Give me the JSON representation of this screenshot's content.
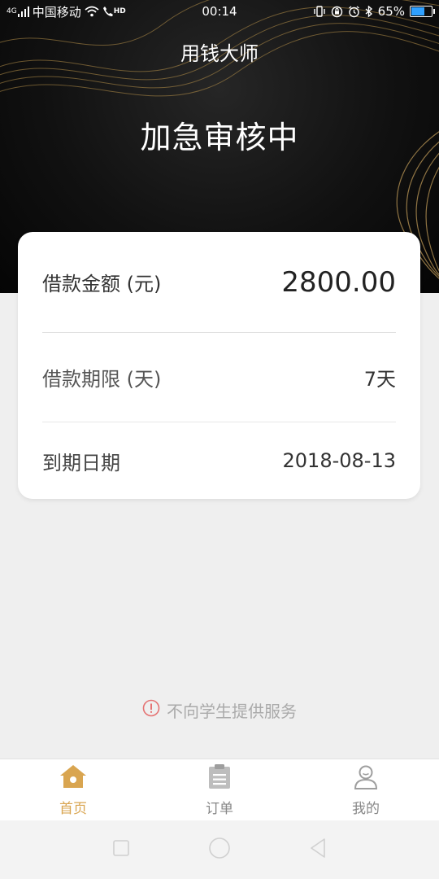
{
  "statusbar": {
    "signal": "4G",
    "carrier": "中国移动",
    "hd": "HD",
    "time": "00:14",
    "battery": "65%",
    "battery_level": 0.65
  },
  "header": {
    "app_title": "用钱大师",
    "status_heading": "加急审核中"
  },
  "loan": {
    "amount_label": "借款金额 (元)",
    "amount_value": "2800.00",
    "term_label": "借款期限 (天)",
    "term_value": "7天",
    "due_label": "到期日期",
    "due_value": "2018-08-13"
  },
  "notice": {
    "text": "不向学生提供服务"
  },
  "tabs": [
    {
      "label": "首页",
      "icon": "home-icon",
      "active": true
    },
    {
      "label": "订单",
      "icon": "clipboard-icon",
      "active": false
    },
    {
      "label": "我的",
      "icon": "user-icon",
      "active": false
    }
  ],
  "colors": {
    "accent": "#d9a550",
    "hero_bg": "#0a0a0a",
    "page_bg": "#efefef",
    "warning": "#e57373"
  }
}
